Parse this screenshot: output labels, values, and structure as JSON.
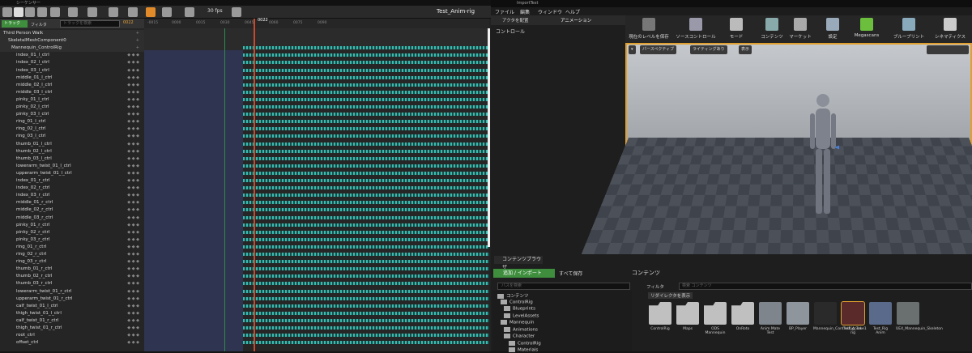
{
  "sequencer": {
    "title": "シーケンサー",
    "fps": "30 fps",
    "seq_name": "Test_Anim-rig",
    "track_btn": "トラック",
    "filter": "フィルタ",
    "search_placeholder": "トラックを検索",
    "timecode": "0022",
    "playhead": "0022",
    "tracks_top": [
      "Third Person Walk",
      "SkeletalMeshComponent0",
      "Mannequin_ControlRig"
    ],
    "controls": [
      "index_01_l_ctrl",
      "index_02_l_ctrl",
      "index_03_l_ctrl",
      "middle_01_l_ctrl",
      "middle_02_l_ctrl",
      "middle_03_l_ctrl",
      "pinky_01_l_ctrl",
      "pinky_02_l_ctrl",
      "pinky_03_l_ctrl",
      "ring_01_l_ctrl",
      "ring_02_l_ctrl",
      "ring_03_l_ctrl",
      "thumb_01_l_ctrl",
      "thumb_02_l_ctrl",
      "thumb_03_l_ctrl",
      "lowerarm_twist_01_l_ctrl",
      "upperarm_twist_01_l_ctrl",
      "index_01_r_ctrl",
      "index_02_r_ctrl",
      "index_03_r_ctrl",
      "middle_01_r_ctrl",
      "middle_02_r_ctrl",
      "middle_03_r_ctrl",
      "pinky_01_r_ctrl",
      "pinky_02_r_ctrl",
      "pinky_03_r_ctrl",
      "ring_01_r_ctrl",
      "ring_02_r_ctrl",
      "ring_03_r_ctrl",
      "thumb_01_r_ctrl",
      "thumb_02_r_ctrl",
      "thumb_03_r_ctrl",
      "lowerarm_twist_01_r_ctrl",
      "upperarm_twist_01_r_ctrl",
      "calf_twist_01_l_ctrl",
      "thigh_twist_01_l_ctrl",
      "calf_twist_01_r_ctrl",
      "thigh_twist_01_r_ctrl",
      "root_ctrl",
      "offset_ctrl"
    ],
    "ruler_ticks": [
      "-0015",
      "0000",
      "0015",
      "0030",
      "0045",
      "0060",
      "0075",
      "0090"
    ]
  },
  "editor": {
    "tab": "ImportTest",
    "menus": [
      "ファイル",
      "編集",
      "ウィンドウ",
      "ヘルプ"
    ],
    "mode_tabs": [
      "アクタを配置",
      "アニメーション"
    ],
    "panel_label": "コントロール",
    "toolbar": [
      "現在のレベルを保存",
      "ソースコントロール",
      "モード",
      "コンテンツ",
      "マーケット",
      "設定",
      "Megascans",
      "ブループリント",
      "シネマティクス"
    ],
    "viewport": {
      "perspective": "パースペクティブ",
      "lit": "ライティングあり",
      "show": "表示"
    }
  },
  "content_browser": {
    "tab": "コンテンツブラウザ",
    "add_import": "追加 / インポート",
    "save_all": "すべて保存",
    "crumb": "コンテンツ",
    "search_placeholder": "パスを検索",
    "filter": "フィルタ",
    "asset_search": "検索 コンテンツ",
    "redirector": "リダイレクタを表示",
    "tree": [
      "コンテンツ",
      "ControlRig",
      "Blueprints",
      "LevelAssets",
      "Mannequin",
      "Animations",
      "Character",
      "ControlRig",
      "Materials"
    ],
    "assets": [
      "ControlRig",
      "Maps",
      "ODS Mannequin",
      "OnRoto",
      "Anim Mate Test",
      "BP_Player",
      "Mannequin_ControlRig_Take1",
      "Test_Anim-rig",
      "Test_Rig Anim",
      "UE4_Mannequin_Skeleton"
    ]
  }
}
